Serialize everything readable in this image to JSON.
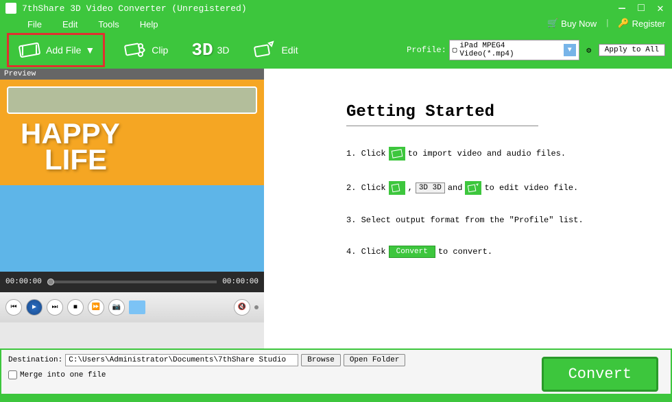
{
  "titlebar": {
    "title": "7thShare 3D Video Converter (Unregistered)"
  },
  "menu": {
    "file": "File",
    "edit": "Edit",
    "tools": "Tools",
    "help": "Help"
  },
  "header_links": {
    "buy_now": "Buy Now",
    "register": "Register"
  },
  "toolbar": {
    "add_file": "Add File",
    "clip": "Clip",
    "three_d": "3D",
    "three_d_label": "3D",
    "edit": "Edit"
  },
  "profile": {
    "label": "Profile:",
    "selected": "iPad MPEG4 Video(*.mp4)",
    "apply_all": "Apply to All"
  },
  "preview": {
    "label": "Preview",
    "happy_life_text": "HAPPY\nLIFE",
    "time_start": "00:00:00",
    "time_end": "00:00:00"
  },
  "getting_started": {
    "title": "Getting Started",
    "step1_prefix": "1. Click",
    "step1_suffix": "to import video and audio files.",
    "step2_prefix": "2. Click",
    "step2_mid": ",",
    "step2_3d_text": "3D 3D",
    "step2_and": "and",
    "step2_suffix": "to edit video file.",
    "step3": "3. Select output format from the \"Profile\" list.",
    "step4_prefix": "4. Click",
    "step4_convert": "Convert",
    "step4_suffix": "to convert."
  },
  "bottom": {
    "destination_label": "Destination:",
    "destination_path": "C:\\Users\\Administrator\\Documents\\7thShare Studio",
    "browse": "Browse",
    "open_folder": "Open Folder",
    "merge": "Merge into one file",
    "convert": "Convert"
  }
}
